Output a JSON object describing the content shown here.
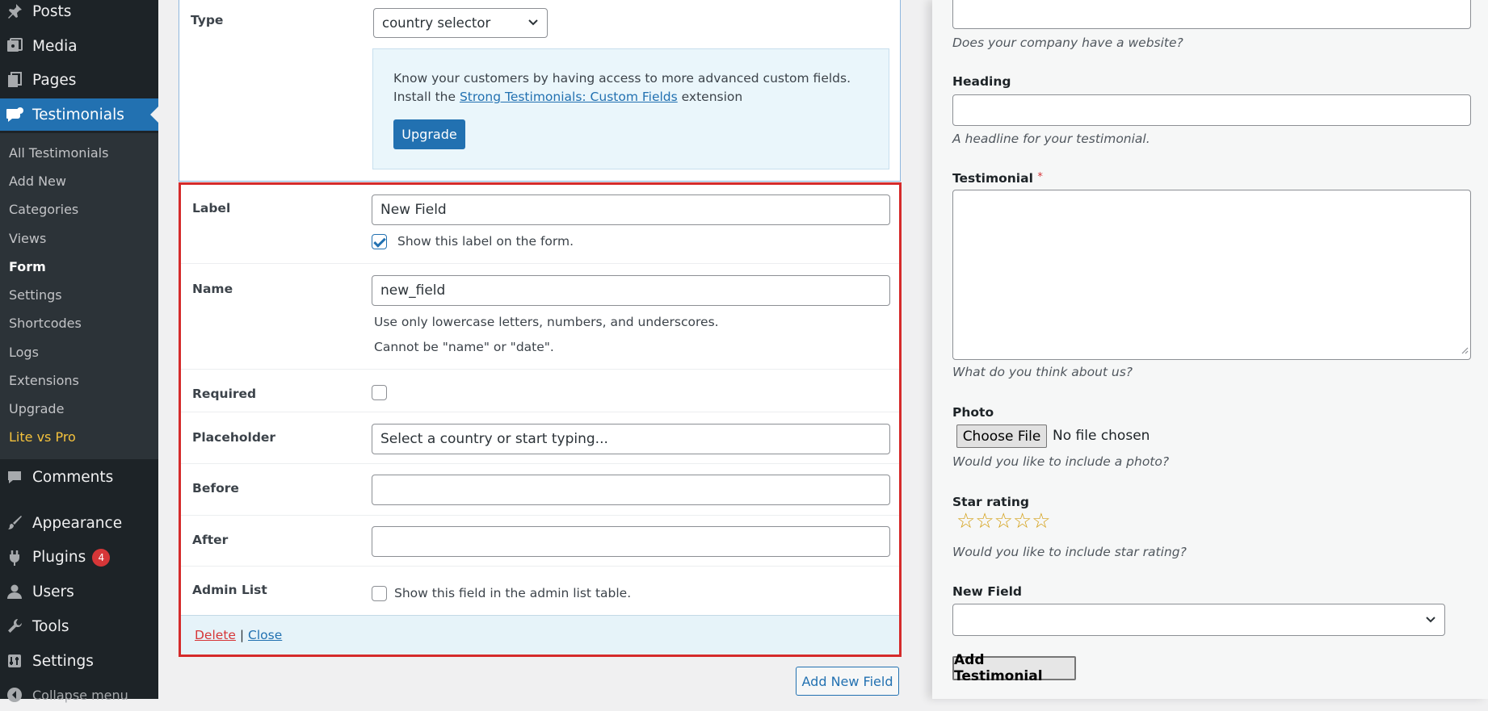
{
  "sidebar": {
    "menu": [
      {
        "label": "Posts",
        "icon": "pushpin-icon"
      },
      {
        "label": "Media",
        "icon": "media-icon"
      },
      {
        "label": "Pages",
        "icon": "pages-icon"
      },
      {
        "label": "Testimonials",
        "icon": "testimonials-icon"
      },
      {
        "label": "Comments",
        "icon": "comment-icon"
      },
      {
        "label": "Appearance",
        "icon": "brush-icon"
      },
      {
        "label": "Plugins",
        "icon": "plugin-icon",
        "badge": "4"
      },
      {
        "label": "Users",
        "icon": "user-icon"
      },
      {
        "label": "Tools",
        "icon": "wrench-icon"
      },
      {
        "label": "Settings",
        "icon": "settings-icon"
      },
      {
        "label": "Collapse menu",
        "icon": "collapse-icon"
      }
    ],
    "submenu": [
      "All Testimonials",
      "Add New",
      "Categories",
      "Views",
      "Form",
      "Settings",
      "Shortcodes",
      "Logs",
      "Extensions",
      "Upgrade",
      "Lite vs Pro"
    ]
  },
  "field_editor": {
    "type_label": "Type",
    "type_value": "country selector",
    "upsell_line1": "Know your customers by having access to more advanced custom fields.",
    "upsell_line2_prefix": "Install the",
    "upsell_link": "Strong Testimonials: Custom Fields",
    "upsell_line2_suffix": "extension",
    "upgrade_button": "Upgrade",
    "label_label": "Label",
    "label_value": "New Field",
    "show_label_text": "Show this label on the form.",
    "show_label_checked": true,
    "name_label": "Name",
    "name_value": "new_field",
    "name_hint1": "Use only lowercase letters, numbers, and underscores.",
    "name_hint2": "Cannot be \"name\" or \"date\".",
    "required_label": "Required",
    "required_checked": false,
    "placeholder_label": "Placeholder",
    "placeholder_value": "Select a country or start typing...",
    "before_label": "Before",
    "before_value": "",
    "after_label": "After",
    "after_value": "",
    "admin_list_label": "Admin List",
    "admin_list_text": "Show this field in the admin list table.",
    "admin_list_checked": false,
    "delete_link": "Delete",
    "separator": "|",
    "close_link": "Close",
    "add_new_field_button": "Add New Field"
  },
  "preview": {
    "website_desc": "Does your company have a website?",
    "heading_label": "Heading",
    "heading_desc": "A headline for your testimonial.",
    "testimonial_label": "Testimonial",
    "required_mark": "*",
    "testimonial_desc": "What do you think about us?",
    "photo_label": "Photo",
    "choose_file_button": "Choose File",
    "no_file_text": "No file chosen",
    "photo_desc": "Would you like to include a photo?",
    "star_label": "Star rating",
    "star_rating": 0,
    "star_max": 5,
    "star_desc": "Would you like to include star rating?",
    "new_field_label": "New Field",
    "submit_button": "Add Testimonial"
  }
}
